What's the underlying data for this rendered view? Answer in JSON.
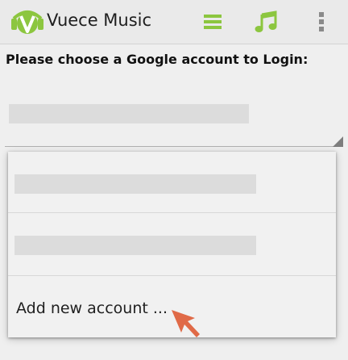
{
  "app": {
    "title": "Vuece Music",
    "logo_icon": "vuece-logo-icon",
    "accent_color": "#8cc63f"
  },
  "actions": {
    "menu_icon": "menu-icon",
    "music_icon": "music-note-icon",
    "overflow_icon": "overflow-icon"
  },
  "page": {
    "prompt": "Please choose a Google account to Login:"
  },
  "dropdown": {
    "options": [
      {
        "label": ""
      },
      {
        "label": ""
      },
      {
        "label": "Add new account ..."
      }
    ]
  },
  "overlay": {
    "pointer_icon": "cursor-arrow-icon",
    "pointer_color": "#e06a47"
  }
}
